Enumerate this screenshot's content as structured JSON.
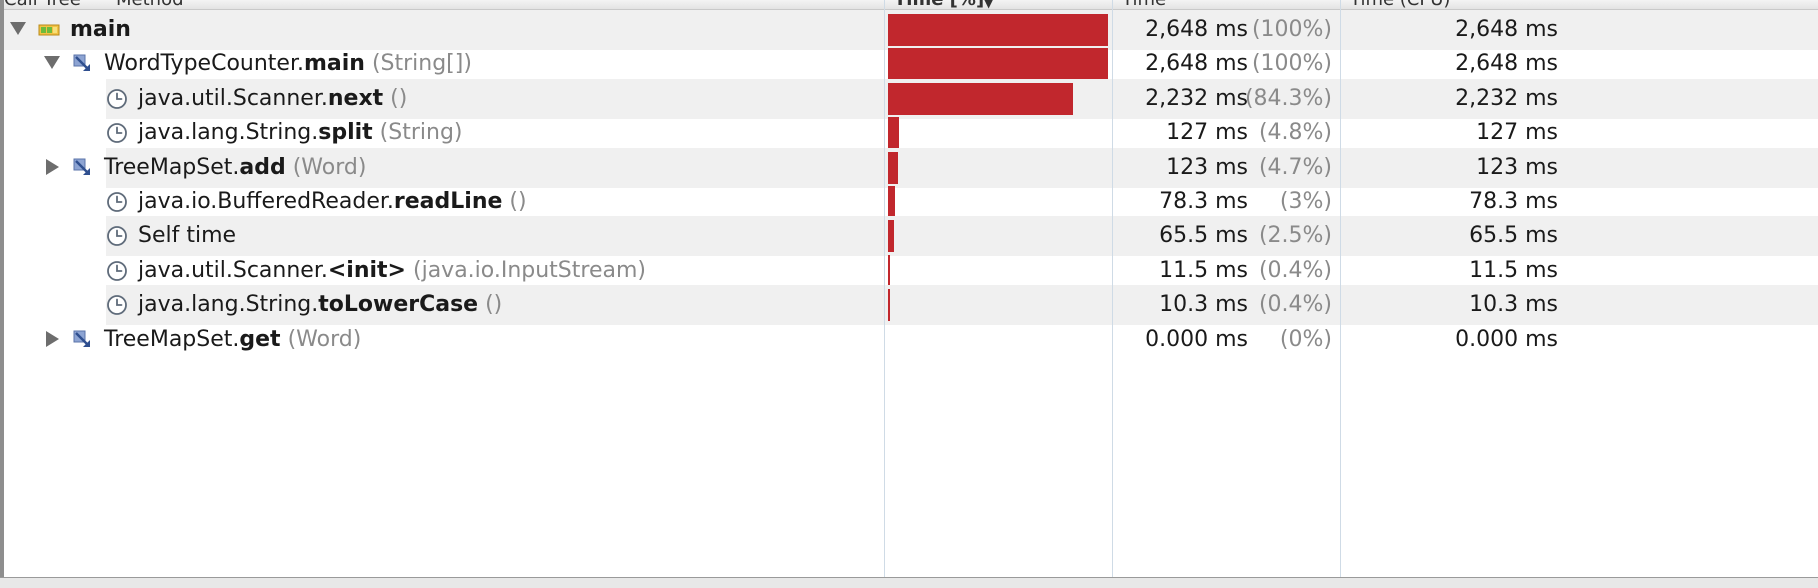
{
  "header": {
    "call_tree": "Call Tree",
    "method": "Method",
    "time_pct": "Time [%]",
    "sort_arrow": "▼",
    "time": "Time",
    "time_cpu": "Time (CPU)"
  },
  "colors": {
    "bar": "#c1272d",
    "row_shade": "#f0f0f0",
    "params_gray": "#8a8a8a"
  },
  "rows": [
    {
      "expander": "expanded",
      "icon": "thread-icon",
      "prefix": "",
      "method": "main",
      "params": "",
      "fraction": 1.0,
      "time": "2,648 ms",
      "percent": "(100%)",
      "cpu": "2,648 ms"
    },
    {
      "expander": "expanded",
      "icon": "method-call-icon",
      "prefix": "WordTypeCounter.",
      "method": "main",
      "params": "(String[])",
      "fraction": 1.0,
      "time": "2,648 ms",
      "percent": "(100%)",
      "cpu": "2,648 ms"
    },
    {
      "expander": "none",
      "icon": "clock-icon",
      "prefix": "java.util.Scanner.",
      "method": "next",
      "params": "()",
      "fraction": 0.843,
      "time": "2,232 ms",
      "percent": "(84.3%)",
      "cpu": "2,232 ms"
    },
    {
      "expander": "none",
      "icon": "clock-icon",
      "prefix": "java.lang.String.",
      "method": "split",
      "params": "(String)",
      "fraction": 0.048,
      "time": "127 ms",
      "percent": "(4.8%)",
      "cpu": "127 ms"
    },
    {
      "expander": "collapsed",
      "icon": "method-call-icon",
      "prefix": "TreeMapSet.",
      "method": "add",
      "params": "(Word)",
      "fraction": 0.047,
      "time": "123 ms",
      "percent": "(4.7%)",
      "cpu": "123 ms"
    },
    {
      "expander": "none",
      "icon": "clock-icon",
      "prefix": "java.io.BufferedReader.",
      "method": "readLine",
      "params": "()",
      "fraction": 0.03,
      "time": "78.3 ms",
      "percent": "(3%)",
      "cpu": "78.3 ms"
    },
    {
      "expander": "none",
      "icon": "clock-icon",
      "prefix": "Self time",
      "method": "",
      "params": "",
      "fraction": 0.025,
      "time": "65.5 ms",
      "percent": "(2.5%)",
      "cpu": "65.5 ms"
    },
    {
      "expander": "none",
      "icon": "clock-icon",
      "prefix": "java.util.Scanner.",
      "method": "<init>",
      "params": "(java.io.InputStream)",
      "fraction": 0.004,
      "time": "11.5 ms",
      "percent": "(0.4%)",
      "cpu": "11.5 ms"
    },
    {
      "expander": "none",
      "icon": "clock-icon",
      "prefix": "java.lang.String.",
      "method": "toLowerCase",
      "params": "()",
      "fraction": 0.004,
      "time": "10.3 ms",
      "percent": "(0.4%)",
      "cpu": "10.3 ms"
    },
    {
      "expander": "collapsed",
      "icon": "method-call-icon",
      "prefix": "TreeMapSet.",
      "method": "get",
      "params": "(Word)",
      "fraction": 0.0,
      "time": "0.000 ms",
      "percent": "(0%)",
      "cpu": "0.000 ms"
    }
  ]
}
